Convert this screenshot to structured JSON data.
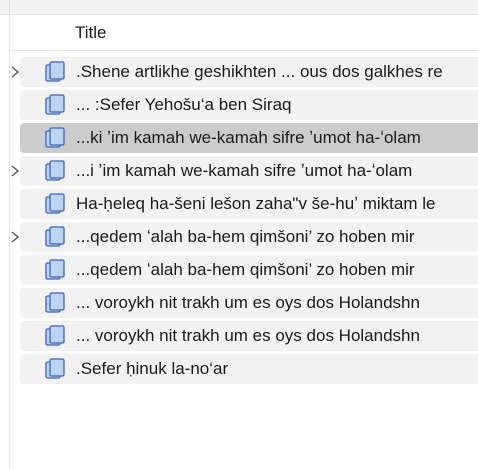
{
  "header": {
    "title_column": "Title"
  },
  "rows": [
    {
      "label": ".Shene artlikhe geshikhten ... ous dos galkhes re",
      "has_children": true,
      "selected": false
    },
    {
      "label": "... :Sefer Yehošu‘a ben Siraq",
      "has_children": false,
      "selected": false
    },
    {
      "label": "...ki ʼim kamah we-kamah sifre ʼumot ha-ʻolam",
      "has_children": false,
      "selected": true
    },
    {
      "label": "...i ʼim kamah we-kamah sifre ʼumot ha-ʻolam",
      "has_children": true,
      "selected": false
    },
    {
      "label": "Ha-ḥeleq ha-šeni lešon zaha\"v še-huʼ miktam le",
      "has_children": false,
      "selected": false
    },
    {
      "label": "...qedem ʻalah ba-hem qimšoni’ zo hoben mir",
      "has_children": true,
      "selected": false
    },
    {
      "label": "...qedem ʻalah ba-hem qimšoni’ zo hoben mir",
      "has_children": false,
      "selected": false
    },
    {
      "label": "... voroykh nit trakh um es oys dos Holandshn",
      "has_children": false,
      "selected": false
    },
    {
      "label": "... voroykh nit trakh um es oys dos Holandshn",
      "has_children": false,
      "selected": false
    },
    {
      "label": ".Sefer ḥinuk la-no‘ar",
      "has_children": false,
      "selected": false
    }
  ],
  "icons": {
    "expand": "chevron-right-icon",
    "document": "document-stack-icon"
  },
  "colors": {
    "doc_fill": "#bcd3f2",
    "doc_stroke": "#3e64b8",
    "row_bg": "#f2f2f2",
    "selected_bg": "#cccccc"
  }
}
